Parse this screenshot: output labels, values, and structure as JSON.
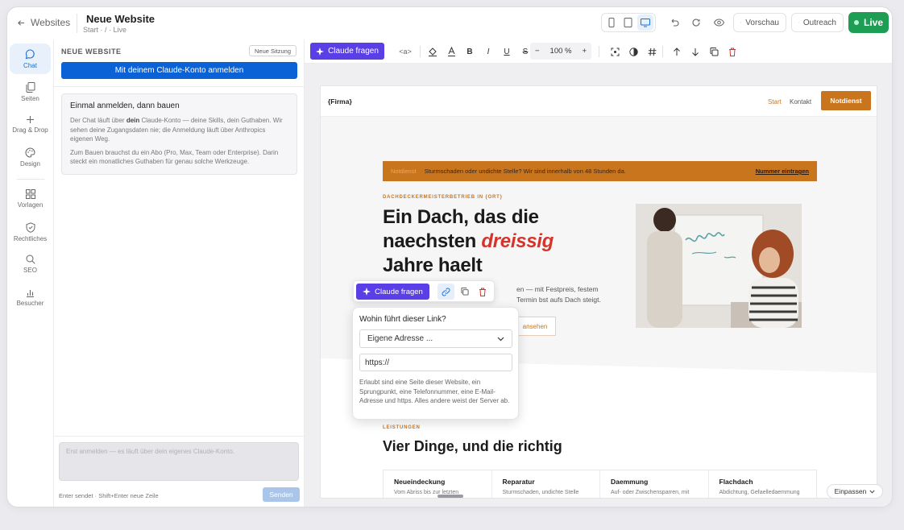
{
  "topbar": {
    "back_label": "Websites",
    "site_title": "Neue Website",
    "site_sub": "Start · / · Live",
    "preview_label": "Vorschau",
    "outreach_label": "Outreach",
    "live_label": "Live"
  },
  "rail": {
    "items": [
      {
        "label": "Chat"
      },
      {
        "label": "Seiten"
      },
      {
        "label": "Drag & Drop"
      },
      {
        "label": "Design"
      },
      {
        "label": "Vorlagen"
      },
      {
        "label": "Rechtliches"
      },
      {
        "label": "SEO"
      },
      {
        "label": "Besucher"
      }
    ]
  },
  "panel": {
    "title": "NEUE WEBSITE",
    "new_session": "Neue Sitzung",
    "login_button": "Mit deinem Claude-Konto anmelden",
    "info_title": "Einmal anmelden, dann bauen",
    "info_p1_a": "Der Chat läuft über ",
    "info_p1_b": "dein",
    "info_p1_c": " Claude-Konto — deine Skills, dein Guthaben. Wir sehen deine Zugangsdaten nie; die Anmeldung läuft über Anthropics eigenen Weg.",
    "info_p2": "Zum Bauen brauchst du ein Abo (Pro, Max, Team oder Enterprise). Darin steckt ein monatliches Guthaben für genau solche Werkzeuge.",
    "chat_placeholder": "Erst anmelden — es läuft über dein eigenes Claude-Konto.",
    "chat_hint": "Enter sendet · Shift+Enter neue Zeile",
    "send_label": "Senden"
  },
  "toolbar": {
    "ask_label": "Claude fragen",
    "tag_label": "<a>",
    "bold": "B",
    "italic": "I",
    "underline": "U",
    "strike": "S",
    "zoom_minus": "−",
    "zoom_value": "100 %",
    "zoom_plus": "+"
  },
  "site": {
    "logo": "{Firma}",
    "nav_start": "Start",
    "nav_kontakt": "Kontakt",
    "nav_cta": "Notdienst",
    "banner_tag": "Notdienst",
    "banner_text": "Sturmschaden oder undichte Stelle? Wir sind innerhalb von 48 Stunden da.",
    "banner_link": "Nummer eintragen",
    "eyebrow": "DACHDECKERMEISTERBETRIEB IN {ORT}",
    "hero_line1": "Ein Dach, das die",
    "hero_line2a": "naechsten ",
    "hero_line2b": "dreissig",
    "hero_line3": "Jahre haelt",
    "hero_text": "en — mit Festpreis, festem Termin bst aufs Dach steigt.",
    "hero_btn": "ansehen",
    "sec_eyebrow": "LEISTUNGEN",
    "sec_title": "Vier Dinge, und die richtig",
    "cards": [
      {
        "title": "Neueindeckung",
        "text": "Vom Abriss bis zur letzten"
      },
      {
        "title": "Reparatur",
        "text": "Sturmschaden, undichte Stelle"
      },
      {
        "title": "Daemmung",
        "text": "Auf- oder Zwischensparren, mit"
      },
      {
        "title": "Flachdach",
        "text": "Abdichtung, Gefaelledaemmung"
      }
    ]
  },
  "float": {
    "ask_label": "Claude fragen"
  },
  "popover": {
    "label": "Wohin führt dieser Link?",
    "select_value": "Eigene Adresse ...",
    "input_value": "https://",
    "help": "Erlaubt sind eine Seite dieser Website, ein Sprungpunkt, eine Telefonnummer, eine E-Mail-Adresse und https. Alles andere weist der Server ab."
  },
  "fit_label": "Einpassen",
  "colors": {
    "accent_blue": "#0b62d6",
    "claude_purple": "#5b3fe6",
    "live_green": "#1e9d55",
    "brand_orange": "#c9751e",
    "hero_red": "#d4342a"
  },
  "icons": [
    "arrow-left-icon",
    "phone-icon",
    "tablet-icon",
    "desktop-icon",
    "undo-icon",
    "redo-icon",
    "eye-icon",
    "square-icon",
    "chat-icon",
    "pages-icon",
    "plus-icon",
    "palette-icon",
    "grid-icon",
    "shield-icon",
    "search-icon",
    "bar-chart-icon",
    "sparkle-icon",
    "paint-bucket-icon",
    "text-color-icon",
    "focus-icon",
    "contrast-icon",
    "hash-icon",
    "arrow-up-icon",
    "arrow-down-icon",
    "copy-icon",
    "trash-icon",
    "link-icon",
    "chevron-down-icon"
  ]
}
